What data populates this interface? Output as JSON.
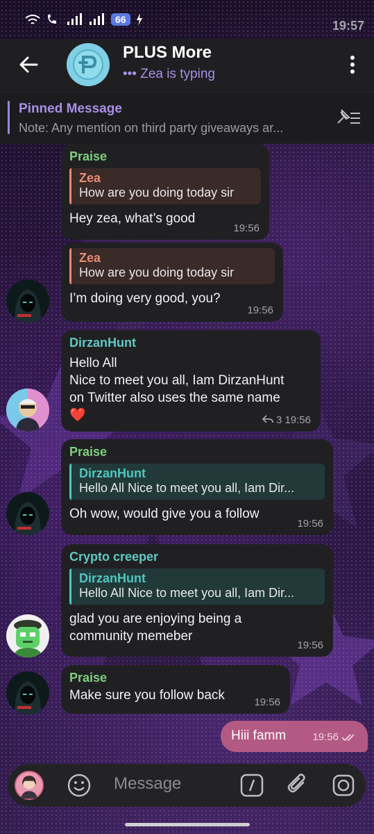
{
  "status_bar": {
    "time": "19:57",
    "battery": "66"
  },
  "header": {
    "title": "PLUS More",
    "subtitle": "••• Zea is typing"
  },
  "pinned": {
    "title": "Pinned Message",
    "text": "Note: Any mention on third party giveaways ar..."
  },
  "messages": [
    {
      "sender": "Praise",
      "reply_name": "Zea",
      "reply_text": "How are you doing today sir",
      "text": "Hey zea, what’s good",
      "time": "19:56"
    },
    {
      "reply_name": "Zea",
      "reply_text": "How are you doing today sir",
      "text": "I’m doing very good, you?",
      "time": "19:56"
    },
    {
      "sender": "DirzanHunt",
      "line1": "Hello All",
      "line2": "Nice to meet you all, Iam DirzanHunt",
      "line3": "on Twitter also uses the same name",
      "emoji": "❤️",
      "replies": "3",
      "time": "19:56"
    },
    {
      "sender": "Praise",
      "reply_name": "DirzanHunt",
      "reply_text": "Hello All  Nice to meet you all, Iam Dir...",
      "text": "Oh wow, would give you a follow",
      "time": "19:56"
    },
    {
      "sender": "Crypto creeper",
      "reply_name": "DirzanHunt",
      "reply_text": "Hello All  Nice to meet you all, Iam Dir...",
      "line1": "glad you are enjoying being a",
      "line2": "community memeber",
      "time": "19:56"
    },
    {
      "sender": "Praise",
      "text": "Make sure you follow back",
      "time": "19:56"
    }
  ],
  "my_message": {
    "text": "Hiii famm",
    "time": "19:56"
  },
  "input": {
    "placeholder": "Message"
  }
}
